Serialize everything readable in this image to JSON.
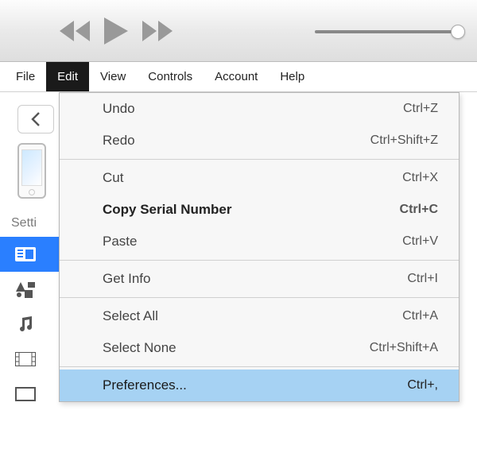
{
  "menubar": {
    "file": "File",
    "edit": "Edit",
    "view": "View",
    "controls": "Controls",
    "account": "Account",
    "help": "Help"
  },
  "sidebar": {
    "settings_label": "Setti"
  },
  "edit_menu": {
    "undo": {
      "label": "Undo",
      "shortcut": "Ctrl+Z"
    },
    "redo": {
      "label": "Redo",
      "shortcut": "Ctrl+Shift+Z"
    },
    "cut": {
      "label": "Cut",
      "shortcut": "Ctrl+X"
    },
    "copy_serial": {
      "label": "Copy Serial Number",
      "shortcut": "Ctrl+C"
    },
    "paste": {
      "label": "Paste",
      "shortcut": "Ctrl+V"
    },
    "get_info": {
      "label": "Get Info",
      "shortcut": "Ctrl+I"
    },
    "select_all": {
      "label": "Select All",
      "shortcut": "Ctrl+A"
    },
    "select_none": {
      "label": "Select None",
      "shortcut": "Ctrl+Shift+A"
    },
    "preferences": {
      "label": "Preferences...",
      "shortcut": "Ctrl+,"
    }
  }
}
